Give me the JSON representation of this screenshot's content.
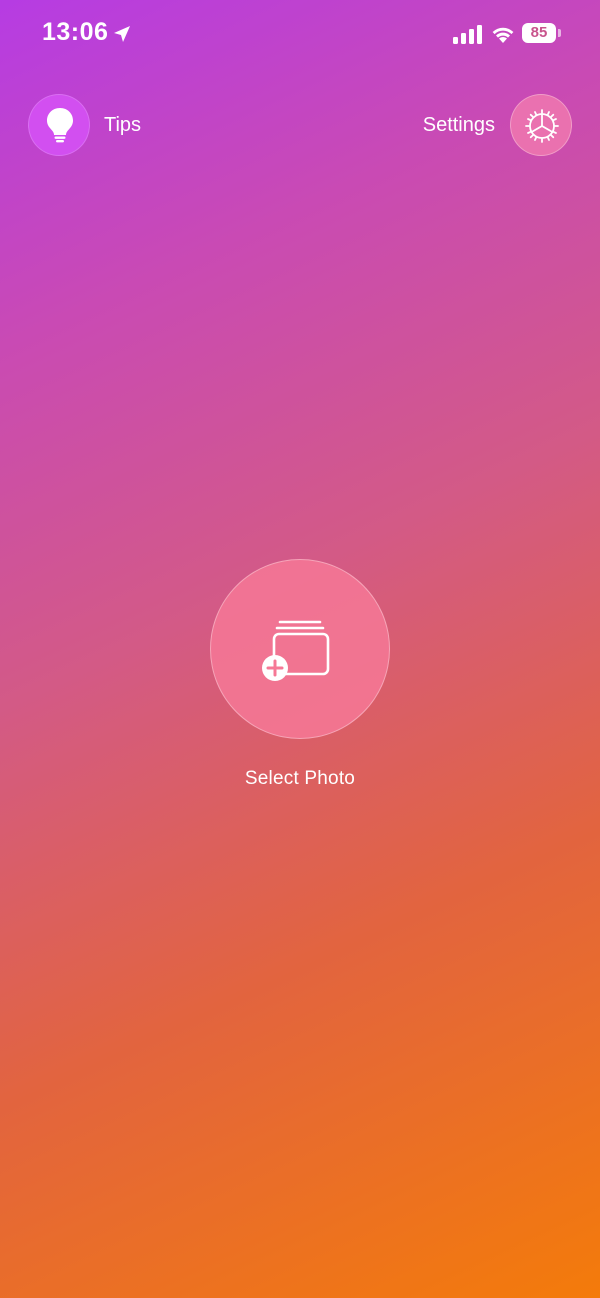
{
  "status_bar": {
    "time": "13:06",
    "battery": "85",
    "location_icon": "location-arrow-icon",
    "signal_icon": "cellular-signal-icon",
    "wifi_icon": "wifi-icon"
  },
  "toolbar": {
    "tips_label": "Tips",
    "tips_icon": "lightbulb-icon",
    "settings_label": "Settings",
    "settings_icon": "aperture-gear-icon"
  },
  "main": {
    "select_photo_label": "Select Photo",
    "select_photo_icon": "add-photos-icon"
  },
  "colors": {
    "gradient_start": "#b63ce3",
    "gradient_end": "#f47b0a",
    "tips_button_bg": "#d24ff0",
    "settings_button_bg": "#f078af",
    "select_button_bg": "#f67896"
  }
}
